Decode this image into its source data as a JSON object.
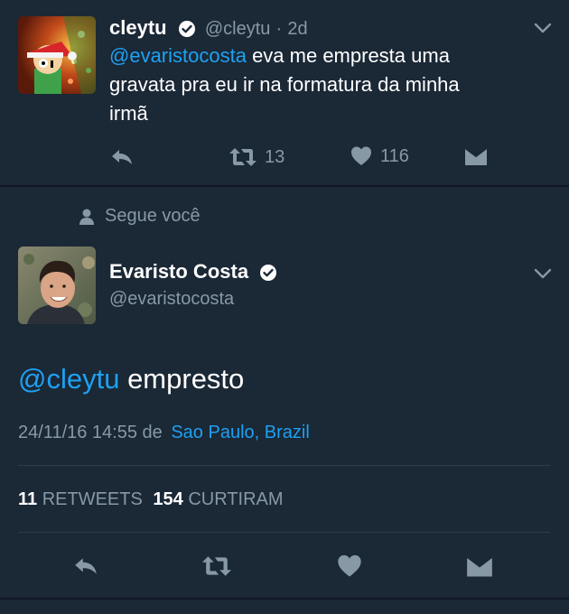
{
  "tweet1": {
    "name": "cleytu",
    "handle": "@cleytu",
    "dot": "·",
    "time": "2d",
    "mention": "@evaristocosta",
    "text_line1": " eva me empresta uma",
    "text_line2": "gravata pra eu ir na formatura da minha",
    "text_line3": "irmã",
    "retweet_count": "13",
    "like_count": "116"
  },
  "follows": {
    "label": "Segue você"
  },
  "tweet2": {
    "name": "Evaristo Costa",
    "handle": "@evaristocosta",
    "mention": "@cleytu",
    "text": " empresto",
    "datetime": "24/11/16 14:55 de",
    "location": "Sao Paulo, Brazil",
    "retweets_count": "11",
    "retweets_label": "RETWEETS",
    "likes_count": "154",
    "likes_label": "CURTIRAM"
  },
  "colors": {
    "background": "#1b2836",
    "accent": "#1da1f2",
    "muted": "#8899a6",
    "verified_bg": "#ffffff"
  },
  "icons": [
    "chevron-down-icon",
    "verified-icon",
    "reply-icon",
    "retweet-icon",
    "heart-icon",
    "direct-message-icon",
    "person-icon"
  ]
}
